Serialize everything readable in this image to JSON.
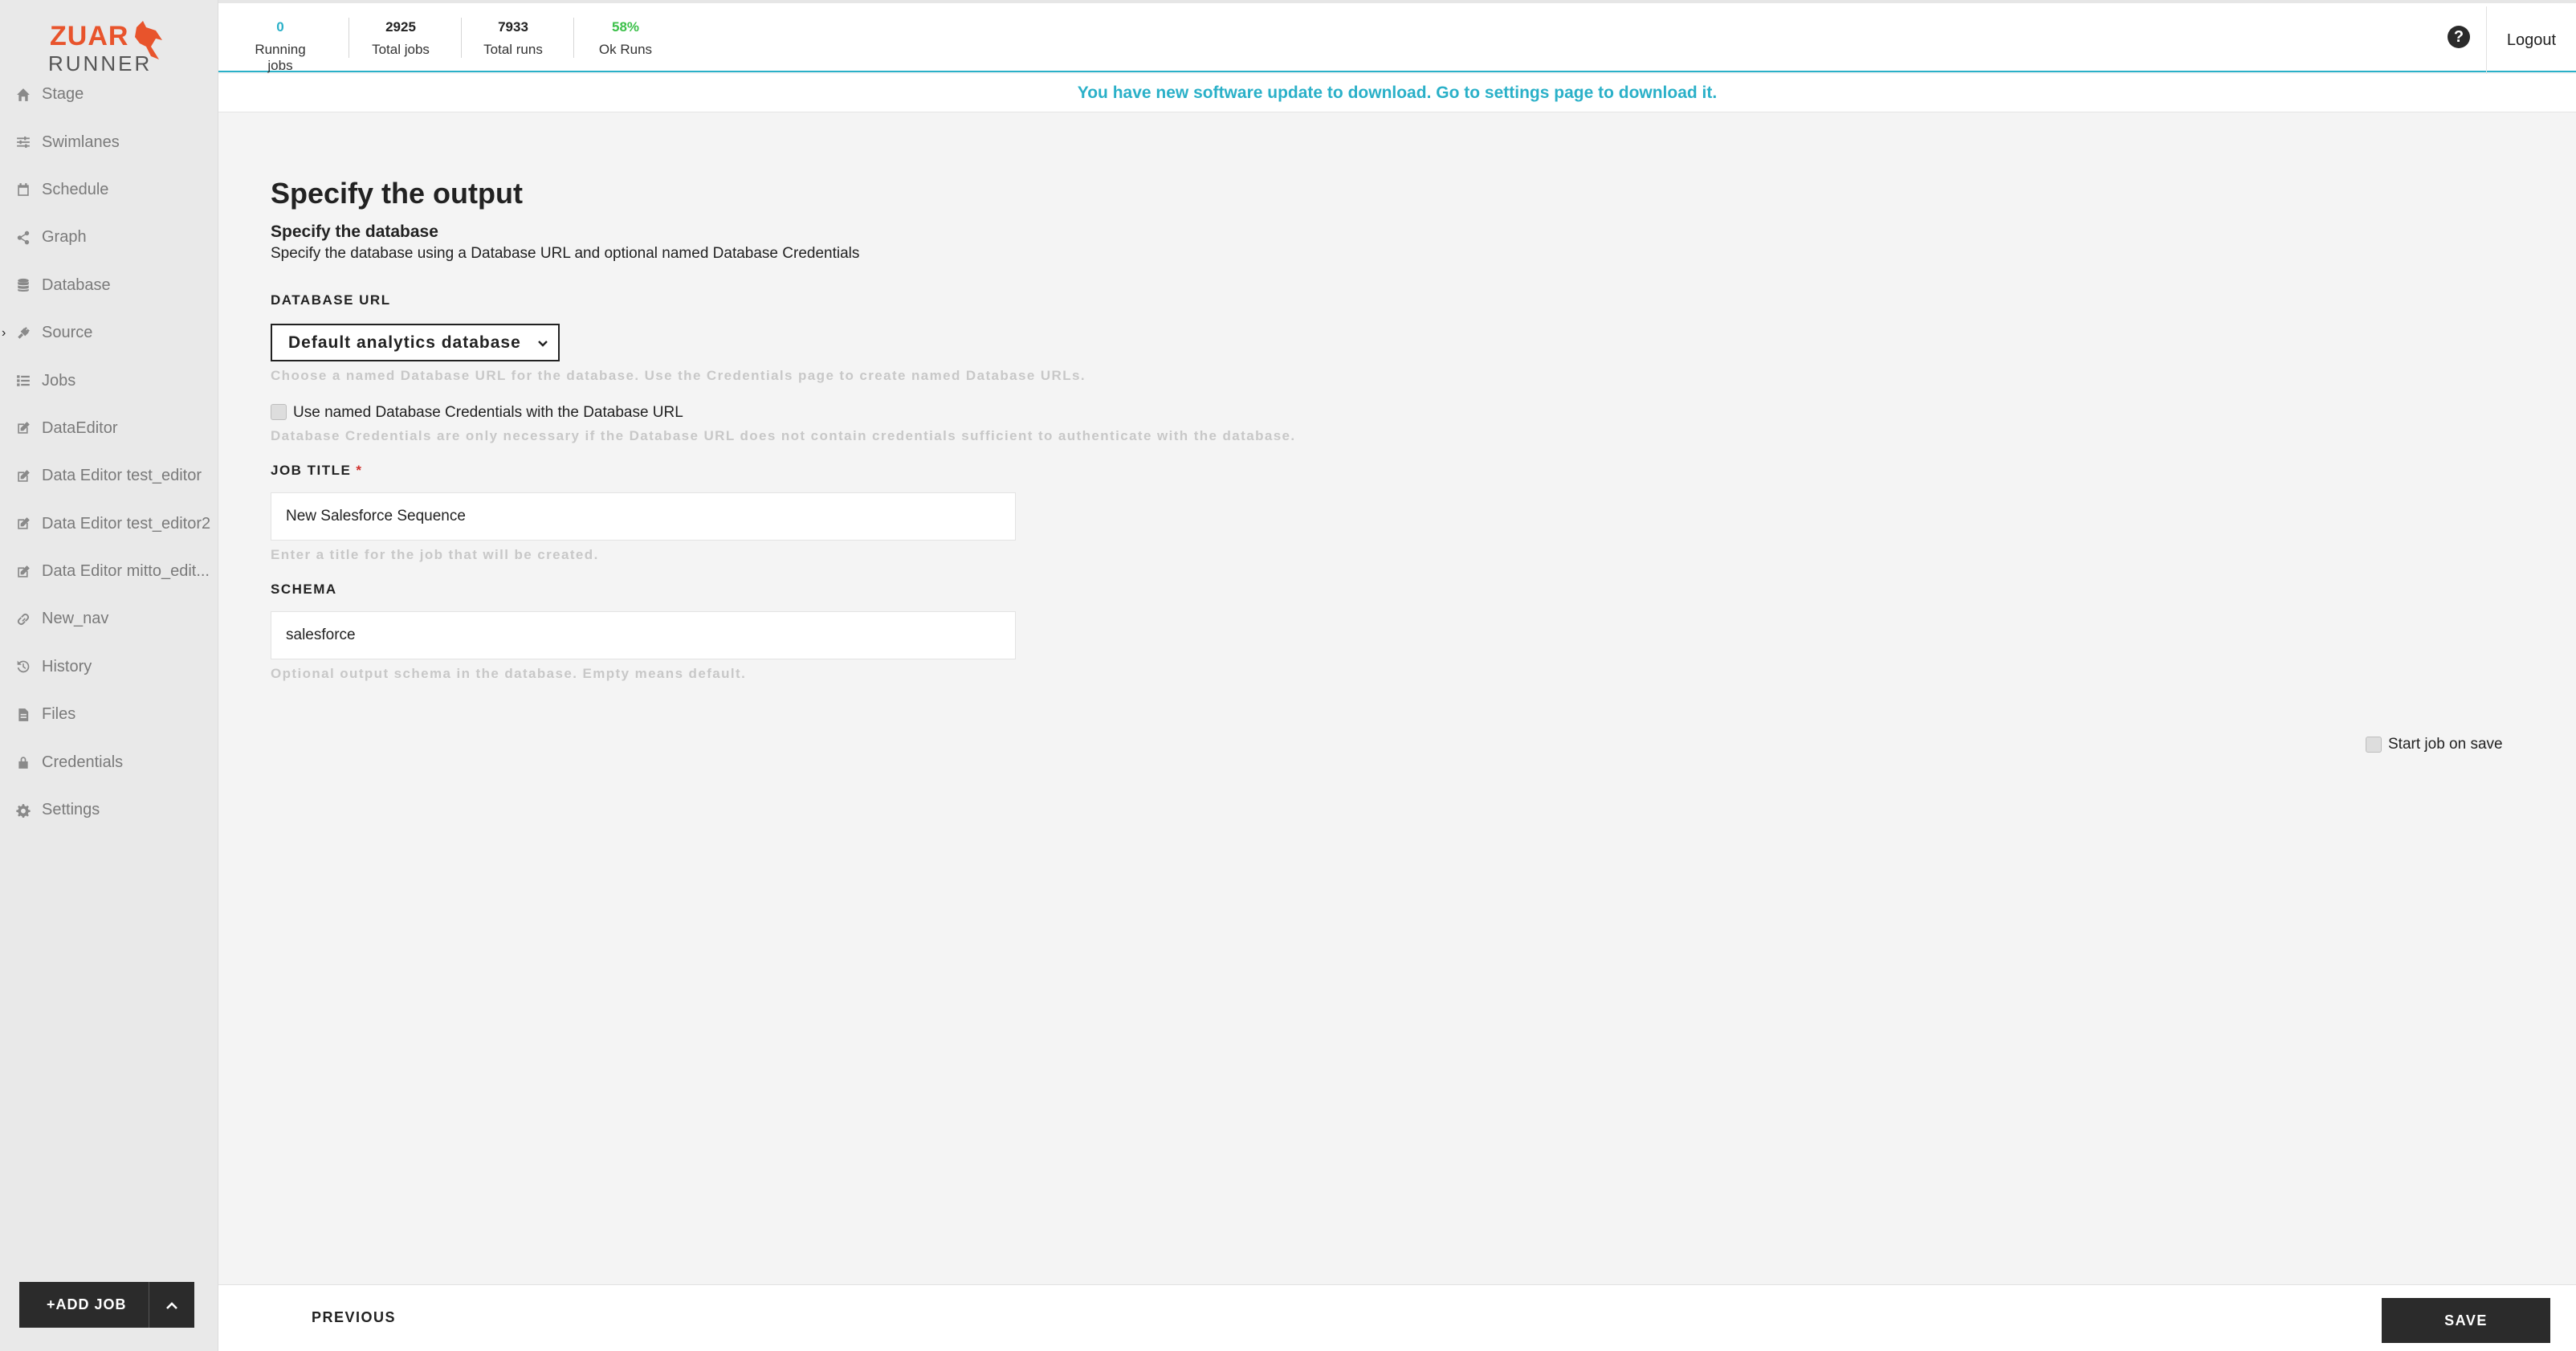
{
  "logo": {
    "line1": "ZUAR",
    "line2": "RUNNER"
  },
  "sidebar": {
    "items": [
      {
        "label": "Stage",
        "icon": "home-icon"
      },
      {
        "label": "Swimlanes",
        "icon": "sliders-icon"
      },
      {
        "label": "Schedule",
        "icon": "calendar-icon"
      },
      {
        "label": "Graph",
        "icon": "share-icon"
      },
      {
        "label": "Database",
        "icon": "database-icon"
      },
      {
        "label": "Source",
        "icon": "plug-icon"
      },
      {
        "label": "Jobs",
        "icon": "list-icon"
      },
      {
        "label": "DataEditor",
        "icon": "edit-icon"
      },
      {
        "label": "Data Editor test_editor",
        "icon": "edit-icon"
      },
      {
        "label": "Data Editor test_editor2",
        "icon": "edit-icon"
      },
      {
        "label": "Data Editor mitto_edit...",
        "icon": "edit-icon"
      },
      {
        "label": "New_nav",
        "icon": "link-icon"
      },
      {
        "label": "History",
        "icon": "history-icon"
      },
      {
        "label": "Files",
        "icon": "file-icon"
      },
      {
        "label": "Credentials",
        "icon": "lock-icon"
      },
      {
        "label": "Settings",
        "icon": "gear-icon"
      }
    ],
    "add_job": "+ADD JOB"
  },
  "stats": {
    "running": {
      "value": "0",
      "label": "Running jobs",
      "color": "#2ab0c8"
    },
    "total_jobs": {
      "value": "2925",
      "label": "Total jobs"
    },
    "total_runs": {
      "value": "7933",
      "label": "Total runs"
    },
    "ok_runs": {
      "value": "58%",
      "label": "Ok Runs",
      "color": "#3cc04a"
    }
  },
  "header": {
    "help": "?",
    "logout": "Logout"
  },
  "banner": {
    "text": "You have new software update to download. Go to settings page to download it."
  },
  "form": {
    "title": "Specify the output",
    "section_title": "Specify the database",
    "section_desc": "Specify the database using a Database URL and optional named Database Credentials",
    "db_url_label": "DATABASE URL",
    "db_url_value": "Default analytics database",
    "db_url_hint": "Choose a named Database URL for the database. Use the Credentials page to create named Database URLs.",
    "use_creds_label": "Use named Database Credentials with the Database URL",
    "use_creds_hint": "Database Credentials are only necessary if the Database URL does not contain credentials sufficient to authenticate with the database.",
    "job_title_label": "JOB TITLE",
    "job_title_required": "*",
    "job_title_value": "New Salesforce Sequence",
    "job_title_hint": "Enter a title for the job that will be created.",
    "schema_label": "SCHEMA",
    "schema_value": "salesforce",
    "schema_hint": "Optional output schema in the database. Empty means default.",
    "start_on_save": "Start job on save"
  },
  "footer": {
    "previous": "PREVIOUS",
    "save": "SAVE"
  }
}
